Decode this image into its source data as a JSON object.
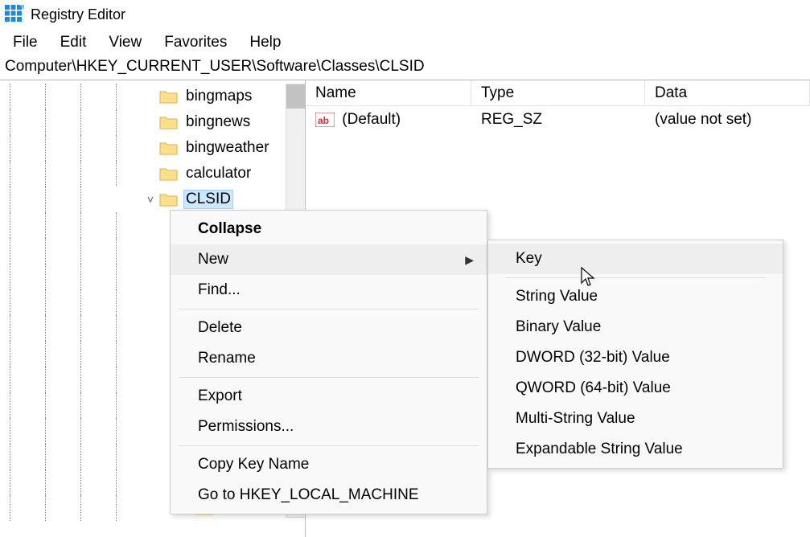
{
  "title": "Registry Editor",
  "menus": {
    "file": "File",
    "edit": "Edit",
    "view": "View",
    "favorites": "Favorites",
    "help": "Help"
  },
  "address": "Computer\\HKEY_CURRENT_USER\\Software\\Classes\\CLSID",
  "tree": {
    "items": [
      {
        "label": "bingmaps",
        "expander": ""
      },
      {
        "label": "bingnews",
        "expander": ""
      },
      {
        "label": "bingweather",
        "expander": ""
      },
      {
        "label": "calculator",
        "expander": ""
      },
      {
        "label": "CLSID",
        "expander": "v",
        "selected": true
      }
    ],
    "child_expander": ">"
  },
  "list": {
    "columns": {
      "name": "Name",
      "type": "Type",
      "data": "Data"
    },
    "rows": [
      {
        "name": "(Default)",
        "type": "REG_SZ",
        "data": "(value not set)"
      }
    ]
  },
  "context_menu": {
    "collapse": "Collapse",
    "new": "New",
    "find": "Find...",
    "delete": "Delete",
    "rename": "Rename",
    "export": "Export",
    "permissions": "Permissions...",
    "copy_key_name": "Copy Key Name",
    "goto": "Go to HKEY_LOCAL_MACHINE"
  },
  "new_submenu": {
    "key": "Key",
    "string": "String Value",
    "binary": "Binary Value",
    "dword": "DWORD (32-bit) Value",
    "qword": "QWORD (64-bit) Value",
    "multi": "Multi-String Value",
    "expand": "Expandable String Value"
  }
}
